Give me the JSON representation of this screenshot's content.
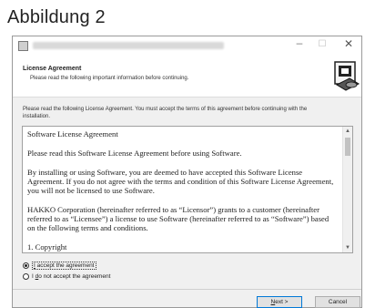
{
  "caption": "Abbildung 2",
  "window": {
    "controls": {
      "minimize": "–",
      "maximize": "☐",
      "close": "✕"
    }
  },
  "header": {
    "title": "License Agreement",
    "subtitle": "Please read the following important information before continuing."
  },
  "intro_text": "Please read the following License Agreement. You must accept the terms of this agreement before continuing with the installation.",
  "license": {
    "paragraphs": [
      "Software License Agreement",
      "Please read this Software License Agreement before using Software.",
      "By installing or using Software, you are deemed to have accepted this Software License Agreement.  If you do not agree with the terms and condition of this Software License Agreement, you will not be licensed to use Software.",
      "HAKKO Corporation (hereinafter referred to as “Licensor”) grants to a customer (hereinafter referred to as “Licensee”) a license to use Software (hereinafter referred to as “Software”) based on the following terms and conditions.",
      "1.   Copyright"
    ]
  },
  "options": {
    "accept": {
      "underlined": "I",
      "rest": " accept the agreement",
      "checked": true
    },
    "decline": {
      "prefix": "I ",
      "underlined": "d",
      "rest": "o not accept the agreement",
      "checked": false
    }
  },
  "buttons": {
    "next": {
      "underlined": "N",
      "rest": "ext >"
    },
    "cancel": "Cancel"
  },
  "scroll": {
    "up": "▲",
    "down": "▼"
  }
}
